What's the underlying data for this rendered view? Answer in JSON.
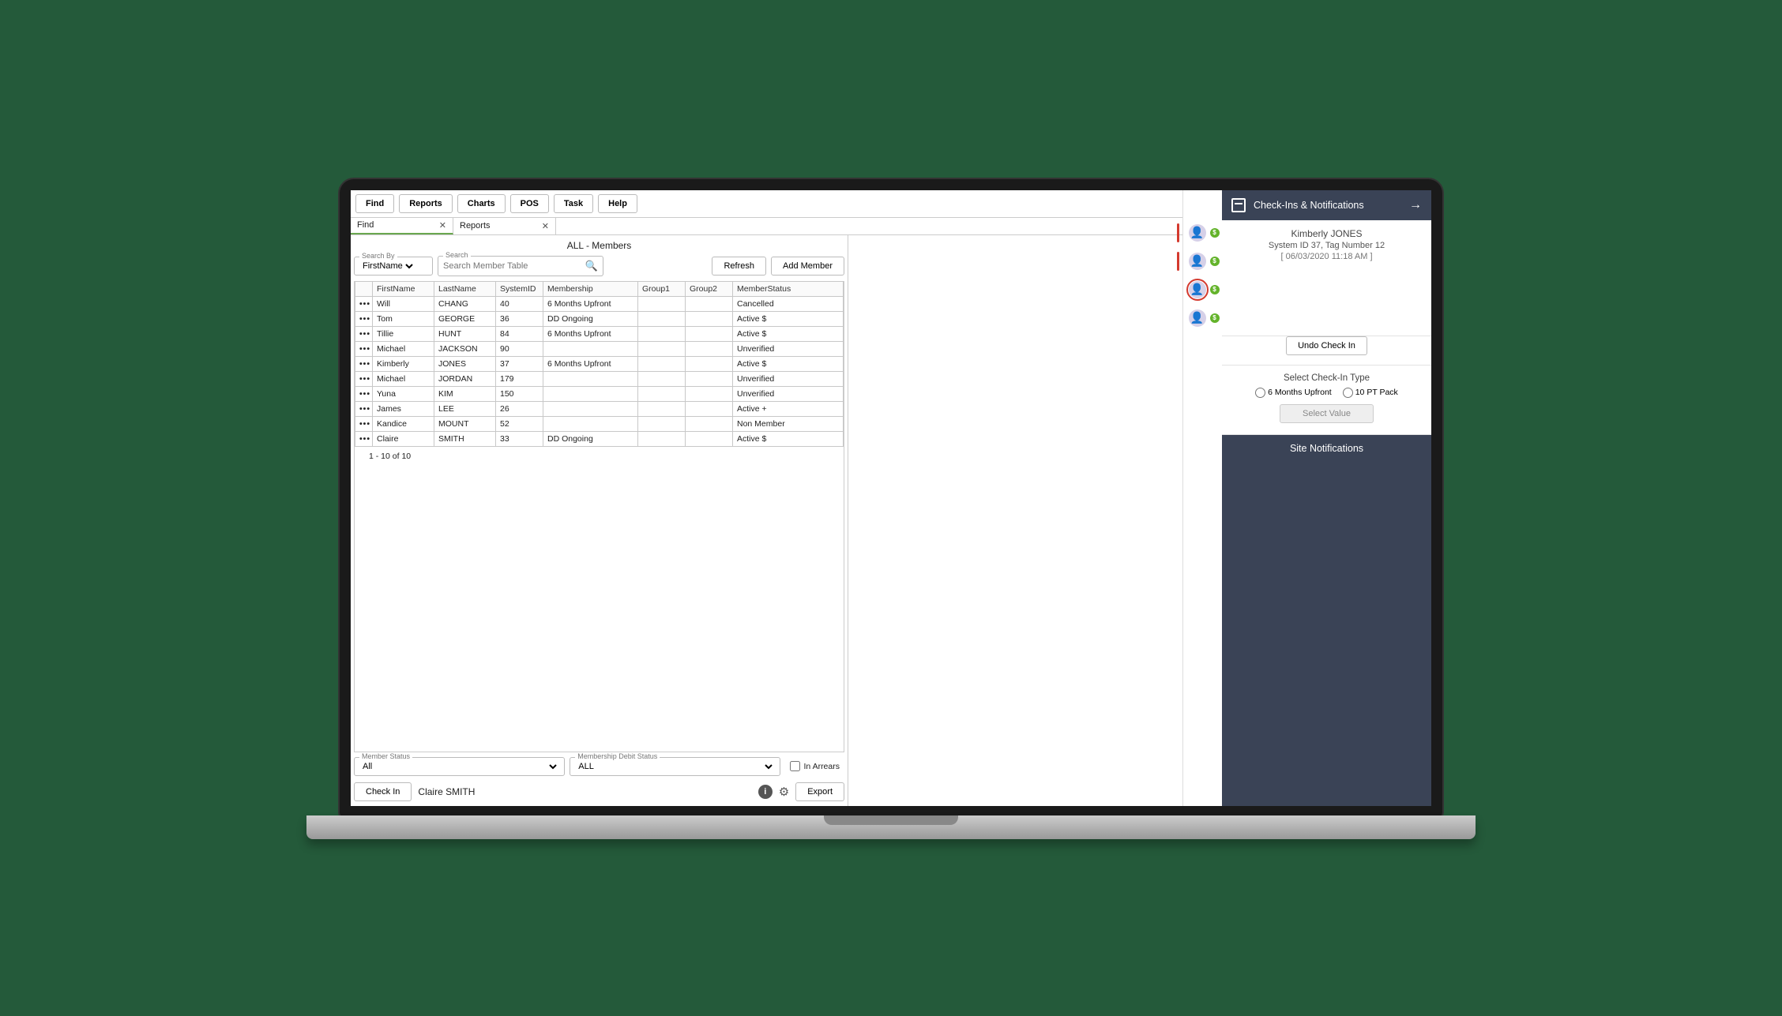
{
  "menubar": [
    "Find",
    "Reports",
    "Charts",
    "POS",
    "Task",
    "Help"
  ],
  "tabs": [
    {
      "label": "Find",
      "active": true
    },
    {
      "label": "Reports",
      "active": false
    }
  ],
  "pane_title": "ALL - Members",
  "search": {
    "by_legend": "Search By",
    "by_value": "FirstName",
    "search_legend": "Search",
    "placeholder": "Search Member Table",
    "refresh": "Refresh",
    "add_member": "Add Member"
  },
  "columns": [
    "FirstName",
    "LastName",
    "SystemID",
    "Membership",
    "Group1",
    "Group2",
    "MemberStatus"
  ],
  "rows": [
    {
      "first": "Will",
      "last": "CHANG",
      "sys": "40",
      "mem": "6 Months Upfront",
      "g1": "",
      "g2": "",
      "status": "Cancelled"
    },
    {
      "first": "Tom",
      "last": "GEORGE",
      "sys": "36",
      "mem": "DD Ongoing",
      "g1": "",
      "g2": "",
      "status": "Active $"
    },
    {
      "first": "Tillie",
      "last": "HUNT",
      "sys": "84",
      "mem": "6 Months Upfront",
      "g1": "",
      "g2": "",
      "status": "Active $"
    },
    {
      "first": "Michael",
      "last": "JACKSON",
      "sys": "90",
      "mem": "",
      "g1": "",
      "g2": "",
      "status": "Unverified"
    },
    {
      "first": "Kimberly",
      "last": "JONES",
      "sys": "37",
      "mem": "6 Months Upfront",
      "g1": "",
      "g2": "",
      "status": "Active $"
    },
    {
      "first": "Michael",
      "last": "JORDAN",
      "sys": "179",
      "mem": "",
      "g1": "",
      "g2": "",
      "status": "Unverified"
    },
    {
      "first": "Yuna",
      "last": "KIM",
      "sys": "150",
      "mem": "",
      "g1": "",
      "g2": "",
      "status": "Unverified"
    },
    {
      "first": "James",
      "last": "LEE",
      "sys": "26",
      "mem": "",
      "g1": "",
      "g2": "",
      "status": "Active +"
    },
    {
      "first": "Kandice",
      "last": "MOUNT",
      "sys": "52",
      "mem": "",
      "g1": "",
      "g2": "",
      "status": "Non Member"
    },
    {
      "first": "Claire",
      "last": "SMITH",
      "sys": "33",
      "mem": "DD Ongoing",
      "g1": "",
      "g2": "",
      "status": "Active $"
    }
  ],
  "row_count": "1 - 10 of 10",
  "filters": {
    "member_status_legend": "Member Status",
    "member_status_value": "All",
    "debit_legend": "Membership Debit Status",
    "debit_value": "ALL",
    "arrears_label": "In Arrears"
  },
  "bottom": {
    "checkin": "Check In",
    "selected": "Claire SMITH",
    "export": "Export"
  },
  "avatars": [
    {
      "bar": "#d43a2f",
      "ring": ""
    },
    {
      "bar": "#d43a2f",
      "ring": ""
    },
    {
      "bar": "",
      "ring": "red"
    },
    {
      "bar": "",
      "ring": ""
    }
  ],
  "sidebar": {
    "header": "Check-Ins & Notifications",
    "member_name": "Kimberly JONES",
    "member_meta": "System ID 37, Tag Number 12",
    "timestamp": "[ 06/03/2020 11:18 AM ]",
    "undo": "Undo Check In",
    "type_label": "Select Check-In Type",
    "opt1": "6 Months Upfront",
    "opt2": "10 PT Pack",
    "select_value": "Select Value",
    "site_notif": "Site Notifications"
  }
}
